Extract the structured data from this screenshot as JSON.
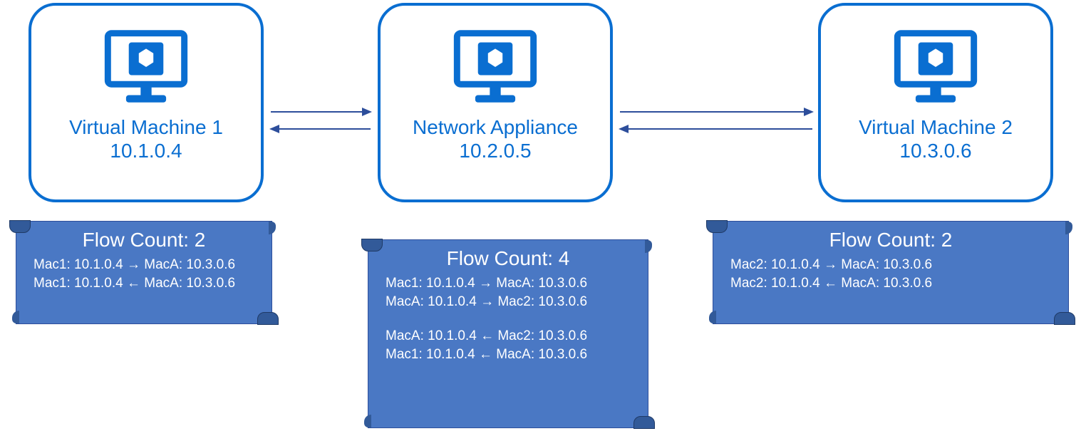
{
  "nodes": {
    "vm1": {
      "label": "Virtual Machine 1",
      "ip": "10.1.0.4"
    },
    "nva": {
      "label": "Network Appliance",
      "ip": "10.2.0.5"
    },
    "vm2": {
      "label": "Virtual Machine 2",
      "ip": "10.3.0.6"
    }
  },
  "flows": {
    "vm1": {
      "title": "Flow Count: 2",
      "rows": [
        "Mac1: 10.1.0.4 → MacA: 10.3.0.6",
        "Mac1: 10.1.0.4 ← MacA: 10.3.0.6"
      ]
    },
    "nva": {
      "title": "Flow Count: 4",
      "rows1": [
        "Mac1: 10.1.0.4 → MacA: 10.3.0.6",
        "MacA: 10.1.0.4 → Mac2: 10.3.0.6"
      ],
      "rows2": [
        "MacA: 10.1.0.4 ← Mac2: 10.3.0.6",
        "Mac1: 10.1.0.4 ← MacA: 10.3.0.6"
      ]
    },
    "vm2": {
      "title": "Flow Count: 2",
      "rows": [
        "Mac2: 10.1.0.4 → MacA: 10.3.0.6",
        "Mac2: 10.1.0.4 ← MacA: 10.3.0.6"
      ]
    }
  }
}
